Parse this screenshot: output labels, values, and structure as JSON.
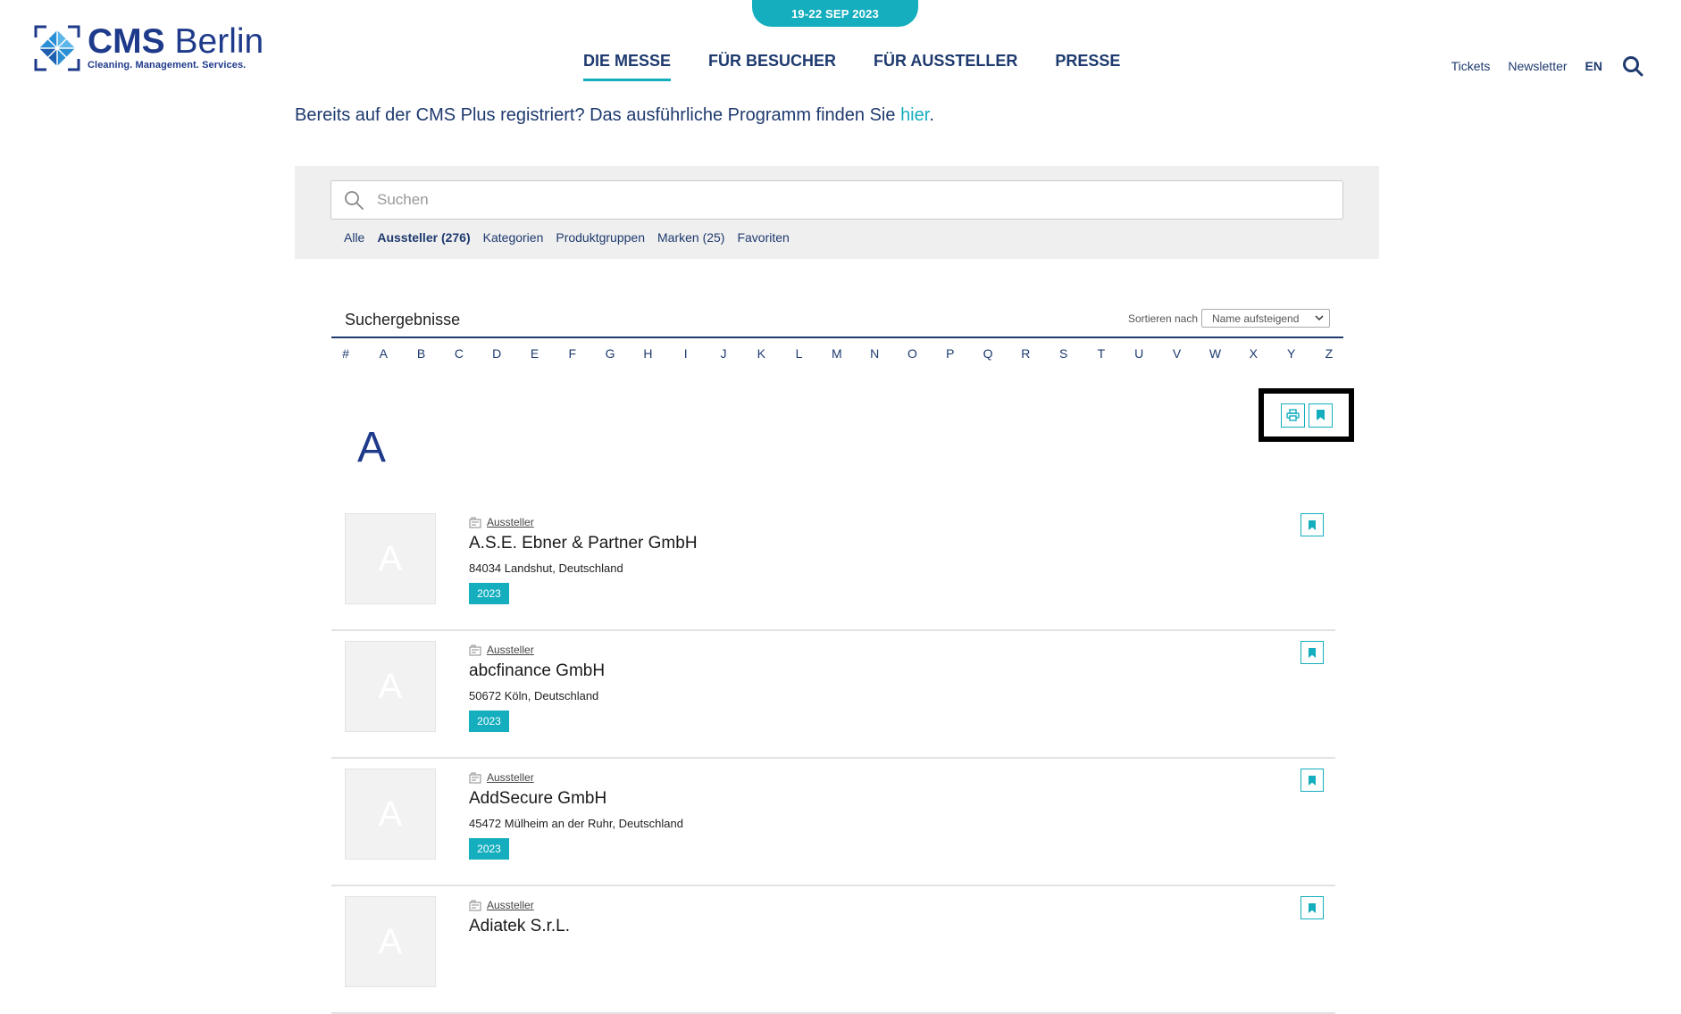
{
  "header": {
    "date_badge": "19-22 SEP 2023",
    "logo": {
      "title_bold": "CMS",
      "title_rest": "Berlin",
      "tagline": "Cleaning. Management. Services."
    },
    "main_nav": [
      "DIE MESSE",
      "FÜR BESUCHER",
      "FÜR AUSSTELLER",
      "PRESSE"
    ],
    "active_nav": "DIE MESSE",
    "util_nav": {
      "tickets": "Tickets",
      "newsletter": "Newsletter",
      "language": "EN"
    },
    "accent_color": "#14aebe",
    "brand_color": "#1e3a8a"
  },
  "intro": {
    "text": "Bereits auf der CMS Plus registriert? Das ausführliche Programm finden Sie ",
    "link": "hier",
    "suffix": "."
  },
  "search": {
    "placeholder": "Suchen",
    "tabs": [
      "Alle",
      "Aussteller (276)",
      "Kategorien",
      "Produktgruppen",
      "Marken (25)",
      "Favoriten"
    ],
    "active_tab": "Aussteller (276)"
  },
  "results": {
    "title": "Suchergebnisse",
    "sort_label": "Sortieren nach",
    "sort_value": "Name aufsteigend",
    "alphabet": [
      "#",
      "A",
      "B",
      "C",
      "D",
      "E",
      "F",
      "G",
      "H",
      "I",
      "J",
      "K",
      "L",
      "M",
      "N",
      "O",
      "P",
      "Q",
      "R",
      "S",
      "T",
      "U",
      "V",
      "W",
      "X",
      "Y",
      "Z"
    ],
    "section_letter": "A",
    "exhibitors": [
      {
        "thumb": "A",
        "type": "Aussteller",
        "name": "A.S.E. Ebner & Partner GmbH",
        "address": "84034 Landshut, Deutschland",
        "badge": "2023"
      },
      {
        "thumb": "A",
        "type": "Aussteller",
        "name": "abcfinance GmbH",
        "address": "50672 Köln, Deutschland",
        "badge": "2023"
      },
      {
        "thumb": "A",
        "type": "Aussteller",
        "name": "AddSecure GmbH",
        "address": "45472 Mülheim an der Ruhr, Deutschland",
        "badge": "2023"
      },
      {
        "thumb": "A",
        "type": "Aussteller",
        "name": "Adiatek S.r.L.",
        "address": "",
        "badge": ""
      }
    ]
  }
}
